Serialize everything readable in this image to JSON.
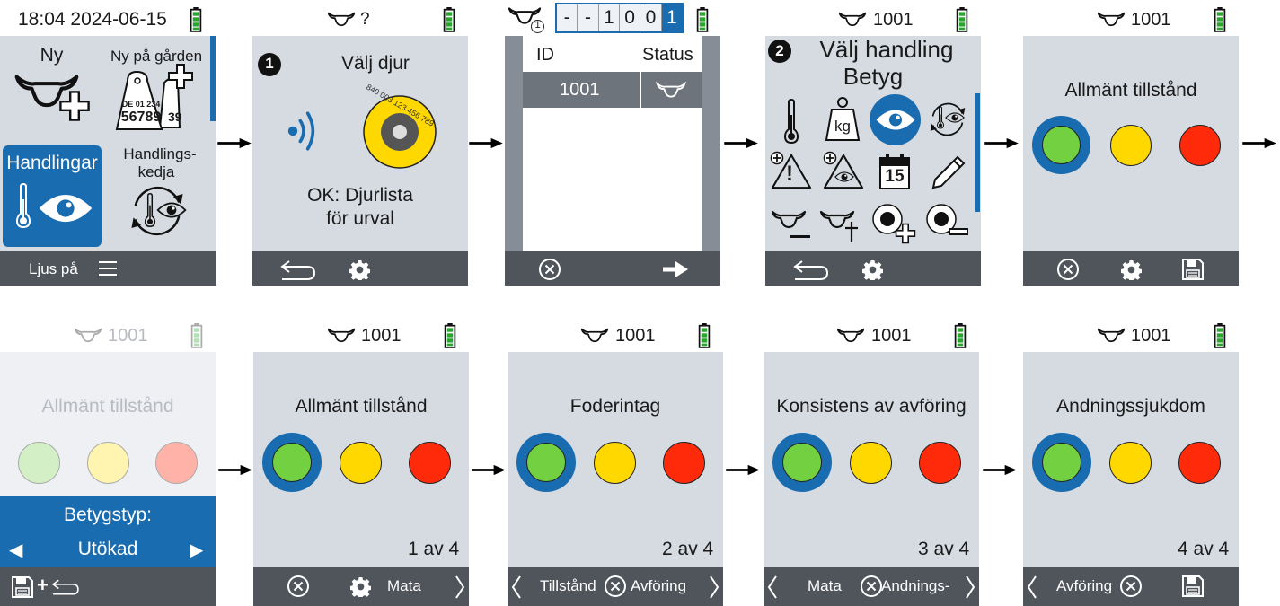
{
  "colors": {
    "screen_bg": "#d6dbe2",
    "bar_bg": "#50555c",
    "accent_blue": "#1a6cb0",
    "green": "#73d040",
    "yellow": "#ffd800",
    "red": "#ff2a0a",
    "battery_green": "#29a52d"
  },
  "p1": {
    "header": "18:04 2024-06-15",
    "new": "Ny",
    "new_on_farm": "Ny på gården",
    "tag_line1": "DE 01 234",
    "tag_line2": "56789",
    "tag_back": "39",
    "actions": "Handlingar",
    "chain_1": "Handlings-",
    "chain_2": "kedja",
    "footer": "Ljus på"
  },
  "p2": {
    "header": "?",
    "step": "1",
    "title": "Välj djur",
    "tag_text": "840 003 123 456 789",
    "ok_1": "OK: Djurlista",
    "ok_2": "för urval"
  },
  "p3": {
    "id_digits": [
      "-",
      "-",
      "1",
      "0",
      "0",
      "1"
    ],
    "badge": "1",
    "col_id": "ID",
    "col_status": "Status",
    "row_id": "1001"
  },
  "p4": {
    "header": "1001",
    "step": "2",
    "title_1": "Välj handling",
    "title_2": "Betyg",
    "kg": "kg",
    "cal": "15"
  },
  "p5": {
    "header": "1001",
    "title": "Allmänt tillstånd"
  },
  "p6": {
    "header": "1001",
    "title": "Allmänt tillstånd",
    "rating_label": "Betygstyp:",
    "rating_value": "Utökad"
  },
  "p7": {
    "header": "1001",
    "title": "Allmänt tillstånd",
    "count": "1 av 4",
    "next": "Mata"
  },
  "p8": {
    "header": "1001",
    "title": "Foderintag",
    "count": "2 av 4",
    "prev": "Tillstånd",
    "next": "Avföring"
  },
  "p9": {
    "header": "1001",
    "title": "Konsistens av avföring",
    "count": "3 av 4",
    "prev": "Mata",
    "next": "Andnings-"
  },
  "p10": {
    "header": "1001",
    "title": "Andningssjukdom",
    "count": "4 av 4",
    "prev": "Avföring"
  }
}
